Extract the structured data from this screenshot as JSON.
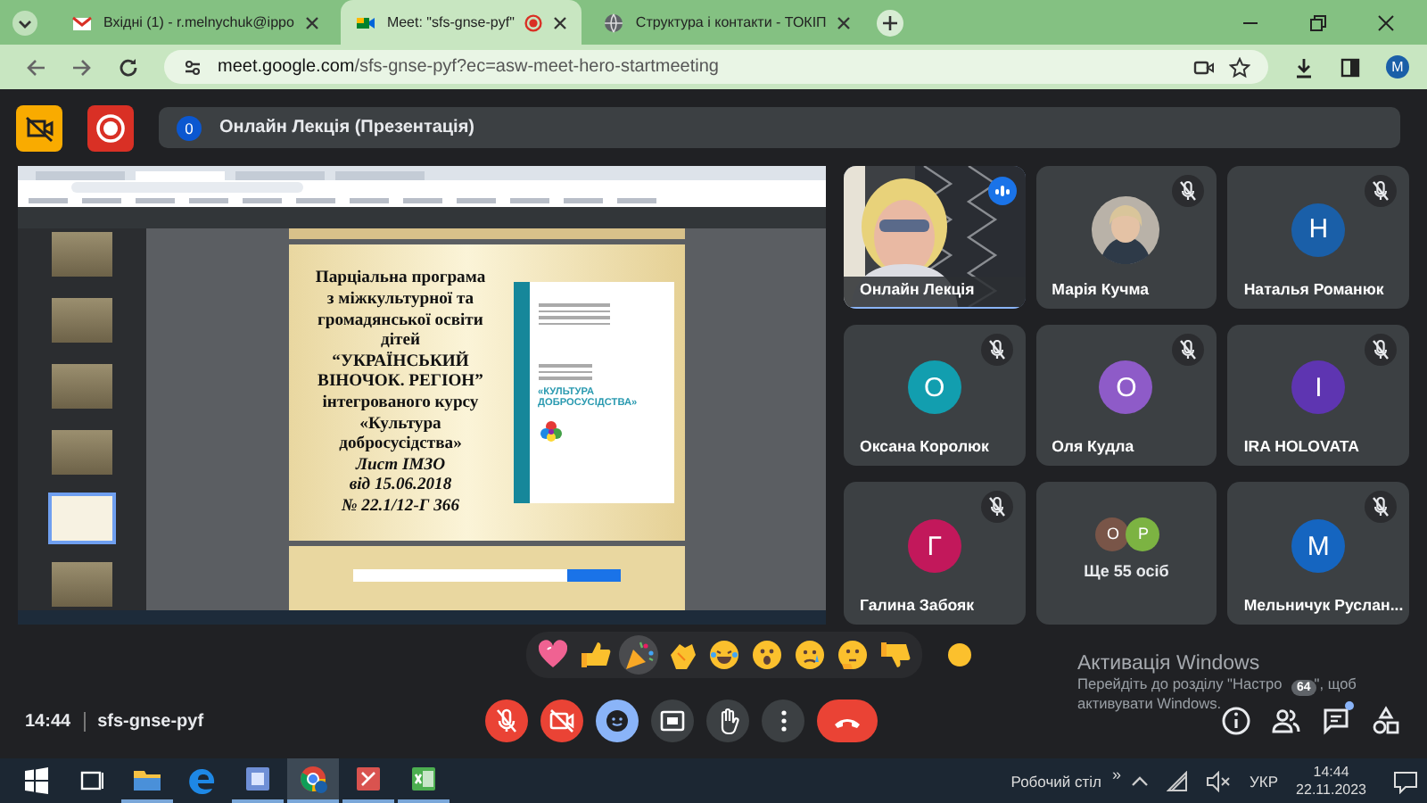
{
  "browser": {
    "tabs": [
      {
        "title": "Вхідні (1) - r.melnychuk@ippo",
        "kind": "mail",
        "selected": false,
        "recording": false
      },
      {
        "title": "Meet: \"sfs-gnse-pyf\"",
        "kind": "meet",
        "selected": true,
        "recording": true
      },
      {
        "title": "Структура і контакти - ТОКІП",
        "kind": "web",
        "selected": false,
        "recording": false
      }
    ],
    "url_host": "meet.google.com",
    "url_path": "/sfs-gnse-pyf?ec=asw-meet-hero-startmeeting",
    "profile_initial": "M"
  },
  "meeting": {
    "count_badge": "0",
    "title": "Онлайн Лекція (Презентація)",
    "presentation": {
      "thumbnails": [
        {
          "selected": false
        },
        {
          "selected": false
        },
        {
          "selected": false
        },
        {
          "selected": false
        },
        {
          "selected": true
        },
        {
          "selected": false
        }
      ],
      "slide_lines": [
        {
          "text": "Парціальна програма",
          "italic": false
        },
        {
          "text": "з міжкультурної та",
          "italic": false
        },
        {
          "text": "громадянської освіти",
          "italic": false
        },
        {
          "text": "дітей",
          "italic": false
        },
        {
          "text": "“УКРАЇНСЬКИЙ",
          "italic": false
        },
        {
          "text": "ВІНОЧОК. РЕГІОН”",
          "italic": false
        },
        {
          "text": "інтегрованого курсу",
          "italic": false
        },
        {
          "text": "«Культура",
          "italic": false
        },
        {
          "text": "добросусідства»",
          "italic": false
        },
        {
          "text": "Лист ІМЗО",
          "italic": true
        },
        {
          "text": "від 15.06.2018",
          "italic": true
        },
        {
          "text": "№ 22.1/12-Г 366",
          "italic": true
        }
      ],
      "book_title": "«КУЛЬТУРА ДОБРОСУСІДСТВА»"
    },
    "participants": [
      {
        "kind": "video",
        "name": "Онлайн Лекція",
        "muted": false,
        "speaking": true
      },
      {
        "name": "Марія Кучма",
        "muted": true,
        "speaking": false
      },
      {
        "kind": "initial",
        "name": "Наталья Романюк",
        "initial": "Н",
        "color": "#1a5fa8",
        "muted": true,
        "speaking": false
      },
      {
        "kind": "initial",
        "name": "Оксана Королюк",
        "initial": "О",
        "color": "#129eaf",
        "muted": true,
        "speaking": false
      },
      {
        "kind": "initial",
        "name": "Оля Кудла",
        "initial": "О",
        "color": "#8e5bc8",
        "muted": true,
        "speaking": false
      },
      {
        "kind": "initial",
        "name": "IRA HOLOVATA",
        "initial": "I",
        "color": "#5e35b1",
        "muted": true,
        "speaking": false
      },
      {
        "kind": "initial",
        "name": "Галина Забояк",
        "initial": "Г",
        "color": "#c2185b",
        "muted": true,
        "speaking": false
      },
      {
        "kind": "others",
        "label": "Ще 55 осіб",
        "avatars": [
          {
            "initial": "О",
            "color": "#795548"
          },
          {
            "initial": "Р",
            "color": "#7cb342"
          }
        ]
      },
      {
        "kind": "initial",
        "name": "Мельничук Руслан...",
        "initial": "М",
        "color": "#1565c0",
        "muted": true,
        "speaking": false
      }
    ],
    "reactions": [
      {
        "kind": "heart",
        "selected": false
      },
      {
        "kind": "thumbs-up",
        "selected": false
      },
      {
        "kind": "party",
        "selected": true
      },
      {
        "kind": "clap",
        "selected": false
      },
      {
        "kind": "laugh",
        "selected": false
      },
      {
        "kind": "surprised",
        "selected": false
      },
      {
        "kind": "sad",
        "selected": false
      },
      {
        "kind": "thinking",
        "selected": false
      },
      {
        "kind": "thumbs-down",
        "selected": false
      }
    ],
    "time": "14:44",
    "code": "sfs-gnse-pyf",
    "controls": [
      {
        "kind": "mic",
        "on": false
      },
      {
        "kind": "camera",
        "on": false
      },
      {
        "kind": "reactions",
        "on": true
      },
      {
        "kind": "present",
        "on": false
      },
      {
        "kind": "hand",
        "on": false
      },
      {
        "kind": "more",
        "on": false
      },
      {
        "kind": "leave"
      }
    ],
    "side_buttons": [
      {
        "kind": "info"
      },
      {
        "kind": "people",
        "badge": "64"
      },
      {
        "kind": "chat",
        "unread": true
      },
      {
        "kind": "activities"
      }
    ]
  },
  "activation_notice": {
    "title": "Активація Windows",
    "line_1_start": "Перейдіть до розділу \"Настро",
    "line_1_end": "\", щоб",
    "line_2": "активувати Windows."
  },
  "taskbar": {
    "apps": [
      {
        "kind": "start",
        "open": false,
        "selected": false
      },
      {
        "kind": "task-view",
        "open": false,
        "selected": false
      },
      {
        "kind": "explorer",
        "open": true,
        "selected": false
      },
      {
        "kind": "edge",
        "open": false,
        "selected": false
      },
      {
        "kind": "viewer",
        "open": true,
        "selected": false
      },
      {
        "kind": "chrome",
        "open": true,
        "selected": true
      },
      {
        "kind": "editor",
        "open": true,
        "selected": false
      },
      {
        "kind": "excel",
        "open": true,
        "selected": false
      }
    ],
    "desktop_label": "Робочий стіл",
    "overflow": "»",
    "language": "УКР",
    "time": "14:44",
    "date": "22.11.2023"
  }
}
